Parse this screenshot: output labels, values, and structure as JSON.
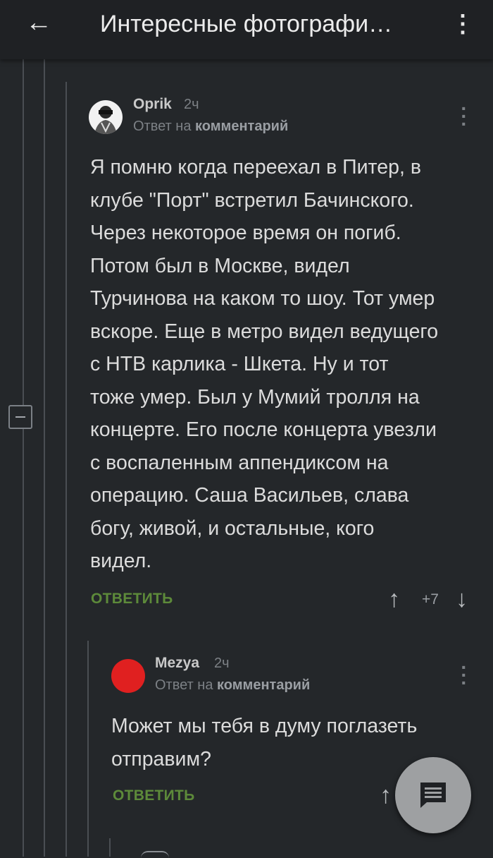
{
  "header": {
    "title": "Интересные фотографи…"
  },
  "comments": [
    {
      "author": "Oprik",
      "time": "2ч",
      "reply_prefix": "Ответ на",
      "reply_target": "комментарий",
      "body_lines": [
        "Я помню когда переехал в Питер, в",
        "клубе \"Порт\" встретил Бачинского.",
        "Через некоторое время он погиб.",
        "Потом был в Москве, видел",
        "Турчинова на каком то шоу. Тот умер",
        "вскоре. Еще в метро видел ведущего",
        "с НТВ карлика - Шкета. Ну и тот",
        "тоже умер. Был у Мумий тролля на",
        "концерте. Его после концерта увезли",
        "с воспаленным аппендиксом на",
        "операцию. Саша Васильев, слава",
        "богу, живой, и остальные, кого",
        "видел."
      ],
      "reply_label": "ОТВЕТИТЬ",
      "score": "+7"
    },
    {
      "author": "Mezya",
      "time": "2ч",
      "reply_prefix": "Ответ на",
      "reply_target": "комментарий",
      "body_lines": [
        "Может мы тебя в думу поглазеть",
        "отправим?"
      ],
      "reply_label": "ОТВЕТИТЬ",
      "avatar_color": "#e02020"
    }
  ],
  "colors": {
    "background": "#24272a",
    "reply_green": "#5d8a3a",
    "fab": "#9ea0a2"
  }
}
